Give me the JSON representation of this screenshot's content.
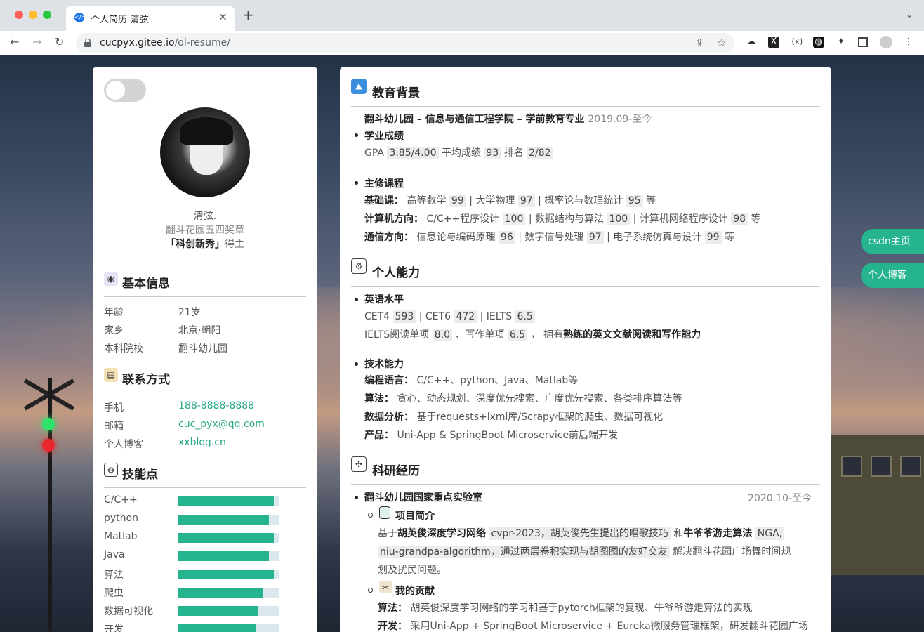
{
  "browser": {
    "tab_title": "个人简历-清弦",
    "url_host": "cucpyx.gitee.io",
    "url_path": "/ol-resume/"
  },
  "profile": {
    "name": "清弦.",
    "award_line1": "翻斗花园五四奖章",
    "award_bold": "「科创新秀」",
    "award_suffix": "得主"
  },
  "basic_info": {
    "title": "基本信息",
    "items": [
      {
        "label": "年龄",
        "value": "21岁"
      },
      {
        "label": "家乡",
        "value": "北京·朝阳"
      },
      {
        "label": "本科院校",
        "value": "翻斗幼儿园"
      }
    ]
  },
  "contact": {
    "title": "联系方式",
    "items": [
      {
        "label": "手机",
        "value": "188-8888-8888"
      },
      {
        "label": "邮箱",
        "value": "cuc_pyx@qq.com"
      },
      {
        "label": "个人博客",
        "value": "xxblog.cn"
      }
    ]
  },
  "skills": {
    "title": "技能点",
    "items": [
      {
        "label": "C/C++",
        "level": 0.95
      },
      {
        "label": "python",
        "level": 0.9
      },
      {
        "label": "Matlab",
        "level": 0.95
      },
      {
        "label": "Java",
        "level": 0.9
      },
      {
        "label": "算法",
        "level": 0.95
      },
      {
        "label": "爬虫",
        "level": 0.85
      },
      {
        "label": "数据可视化",
        "level": 0.8
      },
      {
        "label": "开发",
        "level": 0.78
      }
    ]
  },
  "education": {
    "title": "教育背景",
    "school": "翻斗幼儿园 – 信息与通信工程学院 – 学前教育专业",
    "period": "2019.09-至今",
    "grades_title": "学业成绩",
    "gpa_label": "GPA",
    "gpa": "3.85/4.00",
    "avg_label": "平均成绩",
    "avg": "93",
    "rank_label": "排名",
    "rank": "2/82",
    "courses_title": "主修课程",
    "basic_label": "基础课：",
    "basic": [
      {
        "name": "高等数学",
        "score": "99"
      },
      {
        "name": "大学物理",
        "score": "97"
      },
      {
        "name": "概率论与数理统计",
        "score": "95"
      }
    ],
    "cs_label": "计算机方向：",
    "cs": [
      {
        "name": "C/C++程序设计",
        "score": "100"
      },
      {
        "name": "数据结构与算法",
        "score": "100"
      },
      {
        "name": "计算机网络程序设计",
        "score": "98"
      }
    ],
    "comm_label": "通信方向：",
    "comm": [
      {
        "name": "信息论与编码原理",
        "score": "96"
      },
      {
        "name": "数字信号处理",
        "score": "97"
      },
      {
        "name": "电子系统仿真与设计",
        "score": "99"
      }
    ],
    "etc": "等",
    "sep": "|"
  },
  "ability": {
    "title": "个人能力",
    "english_title": "英语水平",
    "cet4_label": "CET4",
    "cet4": "593",
    "cet6_label": "| CET6",
    "cet6": "472",
    "ielts_label": "| IELTS",
    "ielts": "6.5",
    "reading_label": "IELTS阅读单项",
    "reading": "8.0",
    "writing_label": "、写作单项",
    "writing": "6.5",
    "own_label": "， 拥有",
    "own_bold": "熟练的英文文献阅读和写作能力",
    "tech_title": "技术能力",
    "tech": [
      {
        "label": "编程语言：",
        "value": "C/C++、python、Java、Matlab等"
      },
      {
        "label": "算法：",
        "value": "贪心、动态规划、深度优先搜索、广度优先搜索、各类排序算法等"
      },
      {
        "label": "数据分析：",
        "value": "基于requests+lxml库/Scrapy框架的爬虫、数据可视化"
      },
      {
        "label": "产品：",
        "value": "Uni-App & SpringBoot Microservice前后端开发"
      }
    ]
  },
  "research": {
    "title": "科研经历",
    "lab": "翻斗幼儿园国家重点实验室",
    "period": "2020.10-至今",
    "intro_title": "项目简介",
    "intro_prefix": "基于",
    "intro_bold1": "胡英俊深度学习网络",
    "intro_hl1": "cvpr-2023，胡英俊先生提出的唱歌技巧",
    "intro_and": "和",
    "intro_bold2": "牛爷爷游走算法",
    "intro_hl2": "NGA,",
    "intro_hl3": "niu-grandpa-algorithm，通过两层卷积实现与胡图图的友好交友",
    "intro_rest": "解决翻斗花园广场舞时间规",
    "intro_rest2": "划及扰民问题。",
    "contrib_title": "我的贡献",
    "contrib": [
      {
        "label": "算法：",
        "value": "胡英俊深度学习网络的学习和基于pytorch框架的复现、牛爷爷游走算法的实现"
      },
      {
        "label": "开发：",
        "value": "采用Uni-App + SpringBoot Microservice + Eureka微服务管理框架，研发翻斗花园广场"
      }
    ]
  },
  "side_buttons": [
    "csdn主页",
    "个人博客"
  ]
}
